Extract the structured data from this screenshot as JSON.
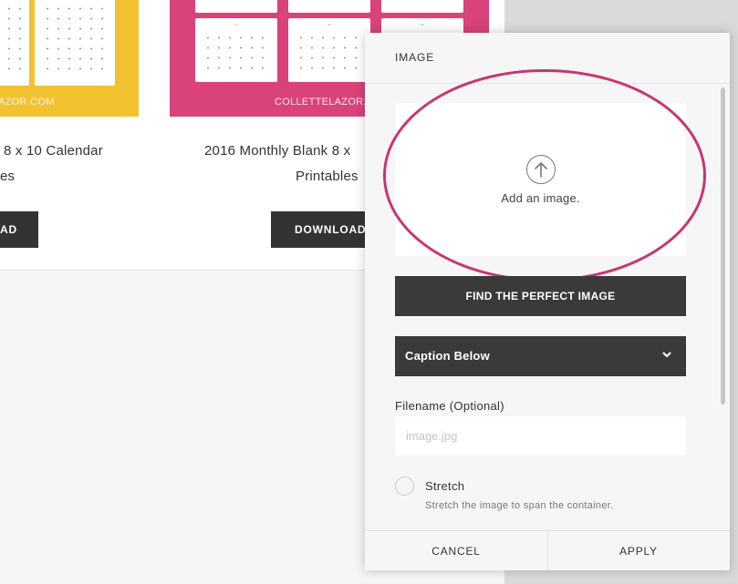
{
  "page": {
    "card1": {
      "watermark": "AZOR.COM",
      "title_line1": "8 x 10 Calendar",
      "title_line2": "es",
      "button": "AD"
    },
    "card2": {
      "watermark": "COLLETTELAZOR.C",
      "title_line1": "2016 Monthly Blank 8 x",
      "title_line2": "Printables",
      "button": "DOWNLOAD"
    }
  },
  "dialog": {
    "title": "IMAGE",
    "drop_zone": {
      "icon": "upload-arrow-icon",
      "text": "Add an image."
    },
    "find_button": "FIND THE PERFECT IMAGE",
    "caption_select": {
      "value": "Caption Below",
      "icon": "chevron-down-icon"
    },
    "filename": {
      "label": "Filename (Optional)",
      "placeholder": "image.jpg",
      "value": ""
    },
    "stretch": {
      "label": "Stretch",
      "description": "Stretch the image to span the container.",
      "checked": false
    },
    "footer": {
      "cancel": "CANCEL",
      "apply": "APPLY"
    }
  },
  "colors": {
    "highlight": "#c8356f",
    "dark_button": "#3a3a3a",
    "yellow_thumb": "#f2c230",
    "pink_thumb": "#d9437a"
  }
}
